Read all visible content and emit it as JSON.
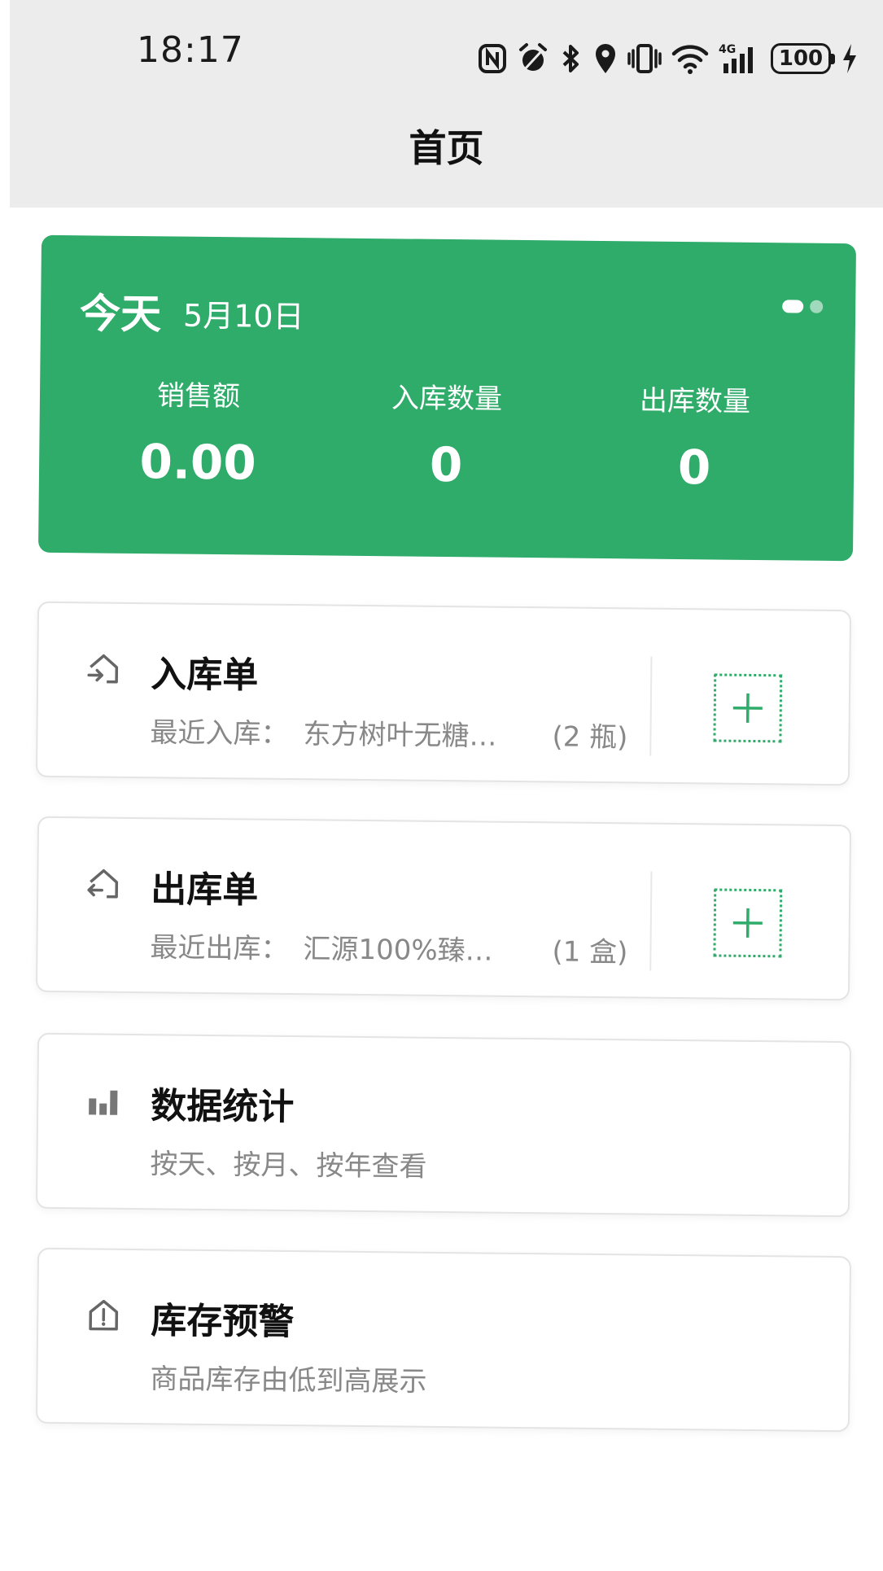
{
  "status_bar": {
    "time": "18:17",
    "network": "4G",
    "battery": "100"
  },
  "header": {
    "title": "首页"
  },
  "summary": {
    "today_label": "今天",
    "date": "5月10日",
    "stats": [
      {
        "label": "销售额",
        "value": "0.00"
      },
      {
        "label": "入库数量",
        "value": "0"
      },
      {
        "label": "出库数量",
        "value": "0"
      }
    ]
  },
  "cards": {
    "inbound": {
      "title": "入库单",
      "recent_label": "最近入库：",
      "recent_item": "东方树叶无糖…",
      "recent_qty": "(2 瓶)"
    },
    "outbound": {
      "title": "出库单",
      "recent_label": "最近出库：",
      "recent_item": "汇源100%臻…",
      "recent_qty": "(1 盒)"
    },
    "stats": {
      "title": "数据统计",
      "subtitle": "按天、按月、按年查看"
    },
    "warning": {
      "title": "库存预警",
      "subtitle": "商品库存由低到高展示"
    }
  },
  "colors": {
    "primary": "#2fab6a",
    "header_bg": "#ececec"
  }
}
